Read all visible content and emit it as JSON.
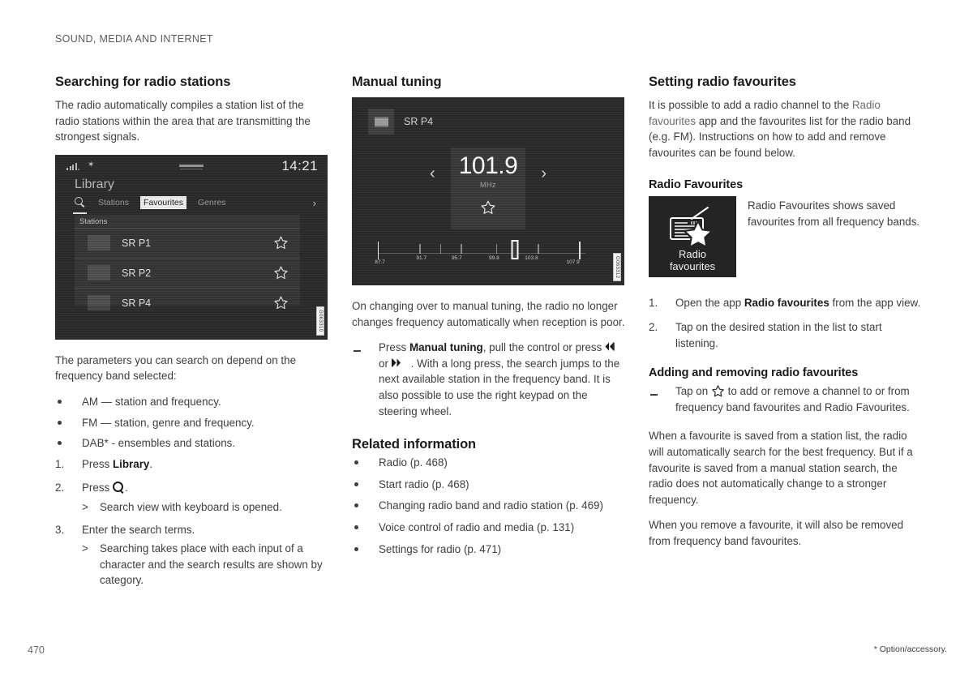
{
  "page": {
    "running_head": "SOUND, MEDIA AND INTERNET",
    "folio": "470",
    "footnote": "* Option/accessory."
  },
  "col1": {
    "heading": "Searching for radio stations",
    "intro": "The radio automatically compiles a station list of the radio stations within the area that are transmitting the strongest signals.",
    "after_image": "The parameters you can search on depend on the frequency band selected:",
    "bullets": [
      "AM — station and frequency.",
      "FM — station, genre and frequency.",
      "DAB* - ensembles and stations."
    ],
    "steps": [
      {
        "num": "1.",
        "text_before": "Press ",
        "bold": "Library",
        "text_after": "."
      },
      {
        "num": "2.",
        "text_before": "Press ",
        "bold": "",
        "text_after": ".",
        "icon": "search-icon",
        "result": "Search view with keyboard is opened."
      },
      {
        "num": "3.",
        "text_before": "Enter the search terms.",
        "bold": "",
        "text_after": "",
        "result": "Searching takes place with each input of a character and the search results are shown by category."
      }
    ],
    "screenshot": {
      "code": "G063310",
      "clock": "14:21",
      "title": "Library",
      "tabs": [
        {
          "label": "Stations",
          "active": false
        },
        {
          "label": "Favourites",
          "active": true
        },
        {
          "label": "Genres",
          "active": false
        }
      ],
      "list_header": "Stations",
      "rows": [
        {
          "label": "SR P1"
        },
        {
          "label": "SR P2"
        },
        {
          "label": "SR P4"
        }
      ]
    }
  },
  "col2": {
    "heading": "Manual tuning",
    "screenshot": {
      "code": "G063312",
      "station": "SR P4",
      "frequency": "101.9",
      "unit": "MHz",
      "scale_labels": [
        "87.7",
        "91.7",
        "95.7",
        "99.8",
        "103.8",
        "107.9"
      ],
      "marker_value": "101.9"
    },
    "para1": "On changing over to manual tuning, the radio no longer changes frequency automatically when reception is poor.",
    "dash_item": {
      "p1": "Press ",
      "bold1": "Manual tuning",
      "p2": ", pull the control or press ",
      "p3": " or ",
      "p4": ". With a long press, the search jumps to the next available station in the frequency band. It is also possible to use the right keypad on the steering wheel."
    },
    "related_heading": "Related information",
    "related": [
      "Radio (p. 468)",
      "Start radio (p. 468)",
      "Changing radio band and radio station (p. 469)",
      "Voice control of radio and media (p. 131)",
      "Settings for radio (p. 471)"
    ]
  },
  "col3": {
    "heading": "Setting radio favourites",
    "intro_p1": "It is possible to add a radio channel to the ",
    "intro_grey": "Radio favourites",
    "intro_p2": " app and the favourites list for the radio band (e.g. FM). Instructions on how to add and remove favourites can be found below.",
    "sub_heading_1": "Radio Favourites",
    "app_tile_label_line1": "Radio",
    "app_tile_label_line2": "favourites",
    "app_caption": "Radio Favourites shows saved favourites from all frequency bands.",
    "steps": [
      {
        "num": "1.",
        "t1": "Open the app ",
        "bold": "Radio favourites",
        "t2": " from the app view."
      },
      {
        "num": "2.",
        "t1": "Tap on the desired station in the list to start listening.",
        "bold": "",
        "t2": ""
      }
    ],
    "sub_heading_2": "Adding and removing radio favourites",
    "dash_item": {
      "p1": "Tap on ",
      "p2": " to add or remove a channel to or from frequency band favourites and Radio Favourites."
    },
    "para_end_1": "When a favourite is saved from a station list, the radio will automatically search for the best frequency. But if a favourite is saved from a manual station search, the radio does not automatically change to a stronger frequency.",
    "para_end_2": "When you remove a favourite, it will also be removed from frequency band favourites."
  }
}
